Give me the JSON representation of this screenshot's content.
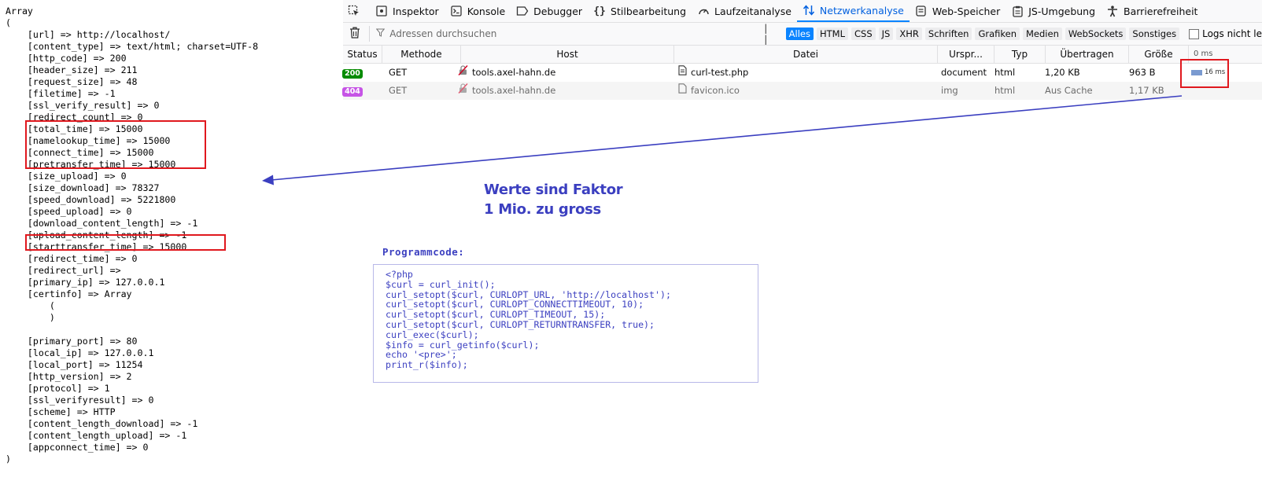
{
  "print_r_output": [
    "Array",
    "(",
    "    [url] => http://localhost/",
    "    [content_type] => text/html; charset=UTF-8",
    "    [http_code] => 200",
    "    [header_size] => 211",
    "    [request_size] => 48",
    "    [filetime] => -1",
    "    [ssl_verify_result] => 0",
    "    [redirect_count] => 0",
    "    [total_time] => 15000",
    "    [namelookup_time] => 15000",
    "    [connect_time] => 15000",
    "    [pretransfer_time] => 15000",
    "    [size_upload] => 0",
    "    [size_download] => 78327",
    "    [speed_download] => 5221800",
    "    [speed_upload] => 0",
    "    [download_content_length] => -1",
    "    [upload_content_length] => -1",
    "    [starttransfer_time] => 15000",
    "    [redirect_time] => 0",
    "    [redirect_url] =>",
    "    [primary_ip] => 127.0.0.1",
    "    [certinfo] => Array",
    "        (",
    "        )",
    "",
    "    [primary_port] => 80",
    "    [local_ip] => 127.0.0.1",
    "    [local_port] => 11254",
    "    [http_version] => 2",
    "    [protocol] => 1",
    "    [ssl_verifyresult] => 0",
    "    [scheme] => HTTP",
    "    [content_length_download] => -1",
    "    [content_length_upload] => -1",
    "    [appconnect_time] => 0",
    ")"
  ],
  "devtools": {
    "tabs": [
      "Inspektor",
      "Konsole",
      "Debugger",
      "Stilbearbeitung",
      "Laufzeitanalyse",
      "Netzwerkanalyse",
      "Web-Speicher",
      "JS-Umgebung",
      "Barrierefreiheit"
    ],
    "active_tab": "Netzwerkanalyse",
    "search_placeholder": "Adressen durchsuchen",
    "pause_label": "| |",
    "filters": [
      "Alles",
      "HTML",
      "CSS",
      "JS",
      "XHR",
      "Schriften",
      "Grafiken",
      "Medien",
      "WebSockets",
      "Sonstiges"
    ],
    "active_filter": "Alles",
    "persist_label": "Logs nicht le",
    "columns": {
      "status": "Status",
      "method": "Methode",
      "host": "Host",
      "file": "Datei",
      "cause": "Urspr...",
      "type": "Typ",
      "transferred": "Übertragen",
      "size": "Größe",
      "waterfall": "0 ms"
    },
    "requests": [
      {
        "status": "200",
        "method": "GET",
        "host": "tools.axel-hahn.de",
        "file": "curl-test.php",
        "cause": "document",
        "type": "html",
        "transferred": "1,20 KB",
        "size": "963 B",
        "timing": "16 ms"
      },
      {
        "status": "404",
        "method": "GET",
        "host": "tools.axel-hahn.de",
        "file": "favicon.ico",
        "cause": "img",
        "type": "html",
        "transferred": "Aus Cache",
        "size": "1,17 KB",
        "timing": ""
      }
    ]
  },
  "annotation": {
    "line1": "Werte sind Faktor",
    "line2": "1 Mio. zu gross"
  },
  "program_label": "Programmcode:",
  "code_lines": [
    "<?php",
    "$curl = curl_init();",
    "curl_setopt($curl, CURLOPT_URL, 'http://localhost');",
    "curl_setopt($curl, CURLOPT_CONNECTTIMEOUT, 10);",
    "curl_setopt($curl, CURLOPT_TIMEOUT, 15);",
    "curl_setopt($curl, CURLOPT_RETURNTRANSFER, true);",
    "curl_exec($curl);",
    "$info = curl_getinfo($curl);",
    "echo '<pre>';",
    "print_r($info);"
  ],
  "colors": {
    "highlight": "#e0181e",
    "annotation": "#3b3fc0",
    "accent": "#0a84ff",
    "status_200": "#058b00",
    "status_404": "#c654e6"
  }
}
